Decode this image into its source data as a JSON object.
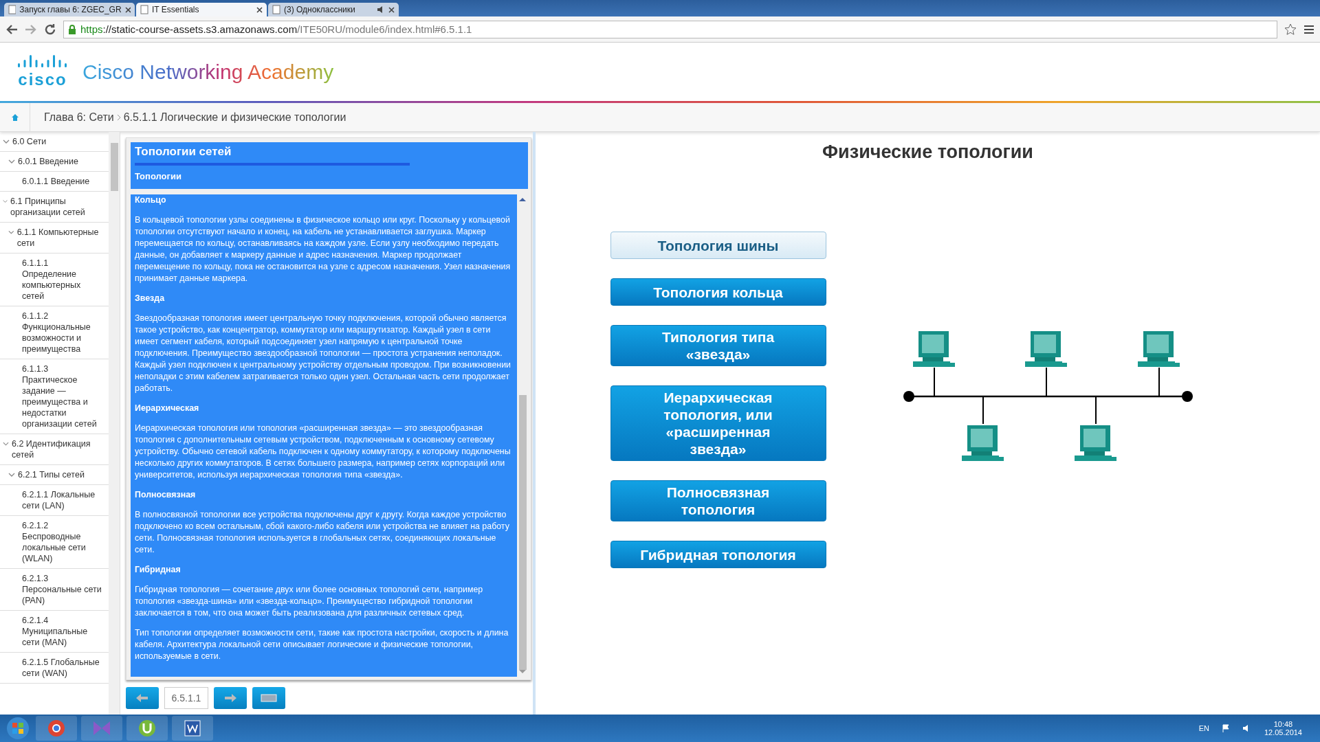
{
  "browser": {
    "tabs": [
      {
        "title": "Запуск главы 6: ZGEC_GR",
        "selected": false,
        "audio": false
      },
      {
        "title": "IT Essentials",
        "selected": true,
        "audio": false
      },
      {
        "title": "(3) Одноклассники",
        "selected": false,
        "audio": true
      }
    ],
    "url": {
      "scheme": "https",
      "host": "://static-course-assets.s3.amazonaws.com",
      "path": "/ITE50RU/module6/index.html#6.5.1.1"
    }
  },
  "header": {
    "logo_word": "cisco",
    "title": "Cisco Networking Academy"
  },
  "breadcrumb": [
    "Глава 6: Сети",
    "6.5.1.1 Логические и физические топологии"
  ],
  "sidebar": {
    "items": [
      {
        "label": "6.0 Сети",
        "expanded": true,
        "children": [
          {
            "label": "6.0.1 Введение",
            "expanded": true,
            "children": [
              {
                "label": "6.0.1.1 Введение"
              }
            ]
          }
        ]
      },
      {
        "label": "6.1 Принципы организации сетей",
        "expanded": true,
        "children": [
          {
            "label": "6.1.1 Компьютерные сети",
            "expanded": true,
            "children": [
              {
                "label": "6.1.1.1 Определение компьютерных сетей"
              },
              {
                "label": "6.1.1.2 Функциональные возможности и преимущества"
              },
              {
                "label": "6.1.1.3 Практическое задание — преимущества и недостатки организации сетей"
              }
            ]
          }
        ]
      },
      {
        "label": "6.2 Идентификация сетей",
        "expanded": true,
        "children": [
          {
            "label": "6.2.1 Типы сетей",
            "expanded": true,
            "children": [
              {
                "label": "6.2.1.1 Локальные сети (LAN)"
              },
              {
                "label": "6.2.1.2 Беспроводные локальные сети (WLAN)"
              },
              {
                "label": "6.2.1.3 Персональные сети (PAN)"
              },
              {
                "label": "6.2.1.4 Муниципальные сети (MAN)"
              },
              {
                "label": "6.2.1.5 Глобальные сети (WAN)"
              }
            ]
          }
        ]
      }
    ]
  },
  "panel": {
    "title": "Топологии сетей",
    "subtitle": "Топологии",
    "content": [
      {
        "kind": "heading",
        "text": "Кольцо"
      },
      {
        "kind": "paragraph",
        "text": "В кольцевой топологии узлы соединены в физическое кольцо или круг. Поскольку у кольцевой топологии отсутствуют начало и конец, на кабель не устанавливается заглушка. Маркер перемещается по кольцу, останавливаясь на каждом узле. Если узлу необходимо передать данные, он добавляет к маркеру данные и адрес назначения. Маркер продолжает перемещение по кольцу, пока не остановится на узле с адресом назначения. Узел назначения принимает данные маркера."
      },
      {
        "kind": "heading",
        "text": "Звезда"
      },
      {
        "kind": "paragraph",
        "text": "Звездообразная топология имеет центральную точку подключения, которой обычно является такое устройство, как концентратор, коммутатор или маршрутизатор. Каждый узел в сети имеет сегмент кабеля, который подсоединяет узел напрямую к центральной точке подключения. Преимущество звездообразной топологии — простота устранения неполадок. Каждый узел подключен к центральному устройству отдельным проводом. При возникновении неполадки с этим кабелем затрагивается только один узел. Остальная часть сети продолжает работать."
      },
      {
        "kind": "heading",
        "text": "Иерархическая"
      },
      {
        "kind": "paragraph",
        "text": "Иерархическая топология или топология «расширенная звезда» — это звездообразная топология с дополнительным сетевым устройством, подключенным к основному сетевому устройству. Обычно сетевой кабель подключен к одному коммутатору, к которому подключены несколько других коммутаторов. В сетях большего размера, например сетях корпораций или университетов, используя иерархическая топология типа «звезда»."
      },
      {
        "kind": "heading",
        "text": "Полносвязная"
      },
      {
        "kind": "paragraph",
        "text": "В полносвязной топологии все устройства подключены друг к другу. Когда каждое устройство подключено ко всем остальным, сбой какого-либо кабеля или устройства не влияет на работу сети. Полносвязная топология используется в глобальных сетях, соединяющих локальные сети."
      },
      {
        "kind": "heading",
        "text": "Гибридная"
      },
      {
        "kind": "paragraph",
        "text": "Гибридная топология — сочетание двух или более основных топологий сети, например топология «звезда-шина» или «звезда-кольцо». Преимущество гибридной топологии заключается в том, что она может быть реализована для различных сетевых сред."
      },
      {
        "kind": "paragraph",
        "text": "Тип топологии определяет возможности сети, такие как простота настройки, скорость и длина кабеля. Архитектура локальной сети описывает логические и физические топологии, используемые в сети."
      }
    ]
  },
  "nav": {
    "page": "6.5.1.1"
  },
  "figure": {
    "title": "Физические топологии",
    "buttons": [
      {
        "label": "Топология шины",
        "selected": true
      },
      {
        "label": "Топология кольца",
        "selected": false
      },
      {
        "label": "Типология типа «звезда»",
        "selected": false
      },
      {
        "label": "Иерархическая топология, или «расширенная звезда»",
        "selected": false
      },
      {
        "label": "Полносвязная топология",
        "selected": false
      },
      {
        "label": "Гибридная топология",
        "selected": false
      }
    ]
  },
  "taskbar": {
    "language": "EN",
    "time": "10:48",
    "date": "12.05.2014"
  }
}
